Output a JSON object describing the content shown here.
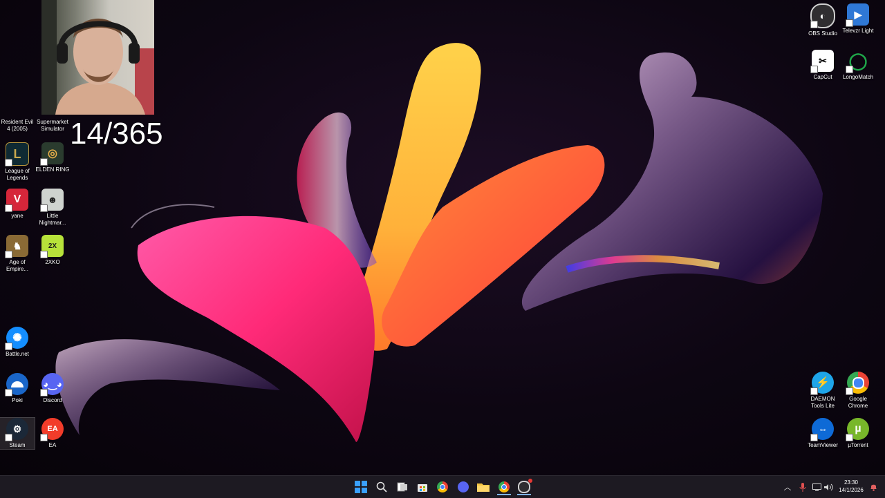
{
  "overlay": {
    "counter": "14/365"
  },
  "desktop_icons": [
    {
      "label": "Resident Evil 4 (2005)",
      "icon": "resident-evil-icon",
      "color": "#2b2b2b"
    },
    {
      "label": "Supermarket Simulator",
      "icon": "supermarket-simulator-icon",
      "color": "#4a6b8a"
    },
    {
      "label": "League of Legends",
      "icon": "league-of-legends-icon",
      "color": "#0f2a33"
    },
    {
      "label": "ELDEN RING",
      "icon": "elden-ring-icon",
      "color": "#2a3b2e"
    },
    {
      "label": "yane",
      "icon": "valorant-icon",
      "color": "#d6263a"
    },
    {
      "label": "Little Nightmar...",
      "icon": "little-nightmares-icon",
      "color": "#cfd3cf"
    },
    {
      "label": "Age of Empire...",
      "icon": "age-of-empires-icon",
      "color": "#8a6a35"
    },
    {
      "label": "2XKO",
      "icon": "2xko-icon",
      "color": "#b7e23a"
    },
    {
      "label": "Battle.net",
      "icon": "battlenet-icon",
      "color": "#148eff"
    },
    {
      "label": "Poki",
      "icon": "poki-icon",
      "color": "#1a66c9"
    },
    {
      "label": "Discord",
      "icon": "discord-icon",
      "color": "#5865f2"
    },
    {
      "label": "Steam",
      "icon": "steam-icon",
      "color": "#1b2838"
    },
    {
      "label": "EA",
      "icon": "ea-icon",
      "color": "#f23c2a"
    },
    {
      "label": "OBS Studio",
      "icon": "obs-studio-icon",
      "color": "#302e31"
    },
    {
      "label": "Televzr Light",
      "icon": "televzr-icon",
      "color": "#2f78d6"
    },
    {
      "label": "CapCut",
      "icon": "capcut-icon",
      "color": "#ffffff"
    },
    {
      "label": "LongoMatch",
      "icon": "longomatch-icon",
      "color": "#1fa84a"
    },
    {
      "label": "DAEMON Tools Lite",
      "icon": "daemon-tools-icon",
      "color": "#1ea5e9"
    },
    {
      "label": "Google Chrome",
      "icon": "chrome-icon",
      "color": "#ffffff"
    },
    {
      "label": "TeamViewer",
      "icon": "teamviewer-icon",
      "color": "#0e6ad6"
    },
    {
      "label": "µTorrent",
      "icon": "utorrent-icon",
      "color": "#78b72a"
    }
  ],
  "taskbar": {
    "apps": [
      {
        "icon": "windows-start-icon"
      },
      {
        "icon": "search-icon"
      },
      {
        "icon": "task-view-icon"
      },
      {
        "icon": "microsoft-store-icon"
      },
      {
        "icon": "chrome-icon"
      },
      {
        "icon": "discord-icon"
      },
      {
        "icon": "file-explorer-icon"
      },
      {
        "icon": "chrome-icon"
      },
      {
        "icon": "obs-studio-icon"
      }
    ],
    "tray": [
      {
        "icon": "chevron-up-icon"
      },
      {
        "icon": "microphone-icon"
      },
      {
        "icon": "network-icon"
      },
      {
        "icon": "volume-icon"
      }
    ],
    "clock": {
      "time": "23:30",
      "date": "14/1/2026"
    },
    "notification_icon": "notification-bell-icon"
  },
  "colors": {
    "taskbar_bg": "#1d1a22",
    "desktop_bg": "#0d0612"
  }
}
